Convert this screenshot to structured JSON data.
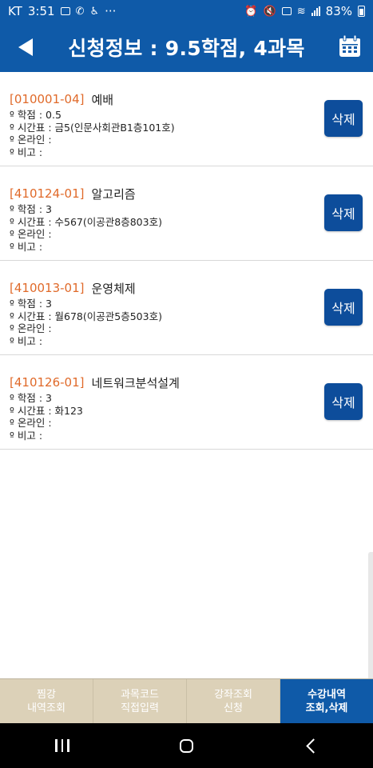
{
  "status_bar": {
    "carrier": "KT",
    "time": "3:51",
    "dots": "···",
    "battery": "83%"
  },
  "header": {
    "title": "신청정보 : 9.5학점,  4과목"
  },
  "courses": [
    {
      "code": "[010001-04]",
      "name": "예배",
      "credit": "º 학점 : 0.5",
      "schedule": "º 시간표 : 금5(인문사회관B1층101호)",
      "online": "º 온라인 :",
      "note": "º 비고 :",
      "delete_label": "삭제"
    },
    {
      "code": "[410124-01]",
      "name": "알고리즘",
      "credit": "º 학점 : 3",
      "schedule": "º 시간표 : 수567(이공관8층803호)",
      "online": "º 온라인 :",
      "note": "º 비고 :",
      "delete_label": "삭제"
    },
    {
      "code": "[410013-01]",
      "name": "운영체제",
      "credit": "º 학점 : 3",
      "schedule": "º 시간표 : 월678(이공관5층503호)",
      "online": "º 온라인 :",
      "note": "º 비고 :",
      "delete_label": "삭제"
    },
    {
      "code": "[410126-01]",
      "name": "네트워크분석설계",
      "credit": "º 학점 : 3",
      "schedule": "º 시간표 : 화123",
      "online": "º 온라인 :",
      "note": "º 비고 :",
      "delete_label": "삭제"
    }
  ],
  "tabs": [
    {
      "line1": "찜강",
      "line2": "내역조회",
      "active": false
    },
    {
      "line1": "과목코드",
      "line2": "직접입력",
      "active": false
    },
    {
      "line1": "강좌조회",
      "line2": "신청",
      "active": false
    },
    {
      "line1": "수강내역",
      "line2": "조회,삭제",
      "active": true
    }
  ],
  "colors": {
    "primary": "#0f5aa8",
    "button": "#0d4d9b",
    "code": "#e06a2a",
    "tab_inactive": "#dcd1b8"
  },
  "icons": {
    "back": "back-arrow-icon",
    "calendar": "calendar-icon"
  }
}
